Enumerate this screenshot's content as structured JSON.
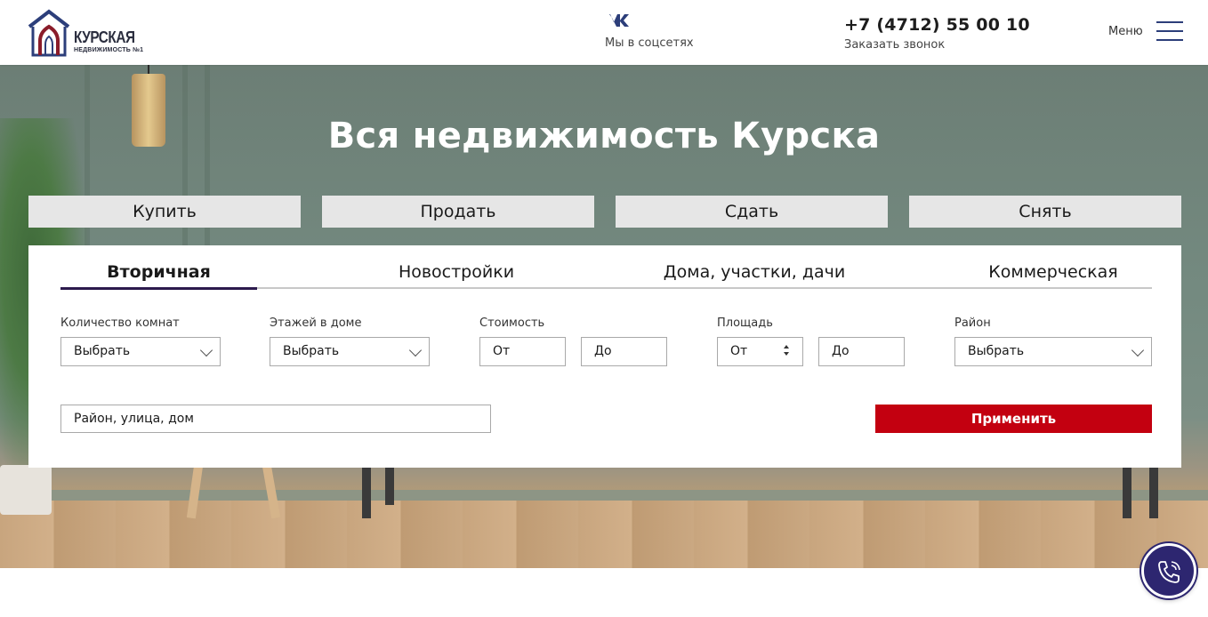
{
  "header": {
    "logo": {
      "title": "КУРСКАЯ",
      "subtitle": "НЕДВИЖИМОСТЬ №1"
    },
    "social": {
      "label": "Мы в соцсетях",
      "icon": "vk-icon"
    },
    "phone": {
      "number": "+7 (4712) 55 00 10",
      "callback_label": "Заказать звонок"
    },
    "menu": {
      "label": "Меню",
      "icon": "hamburger-icon"
    }
  },
  "hero": {
    "title": "Вся недвижимость Курска",
    "deal_tabs": [
      "Купить",
      "Продать",
      "Сдать",
      "Снять"
    ]
  },
  "filter": {
    "type_tabs": [
      "Вторичная",
      "Новостройки",
      "Дома, участки, дачи",
      "Коммерческая"
    ],
    "active_type_tab": "Вторичная",
    "rooms": {
      "label": "Количество комнат",
      "value": "Выбрать"
    },
    "floors": {
      "label": "Этажей в доме",
      "value": "Выбрать"
    },
    "price": {
      "label": "Стоимость",
      "from": "От",
      "to": "До"
    },
    "area": {
      "label": "Площадь",
      "from": "От",
      "to": "До"
    },
    "district": {
      "label": "Район",
      "value": "Выбрать"
    },
    "search": {
      "placeholder": "Район, улица, дом"
    },
    "apply_label": "Применить"
  },
  "colors": {
    "brand_blue": "#2c3e7a",
    "apply_red": "#c30010",
    "call_button": "#2d2670",
    "active_tab_underline": "#2c1a4d"
  },
  "floating": {
    "call_icon": "phone-call-icon"
  }
}
